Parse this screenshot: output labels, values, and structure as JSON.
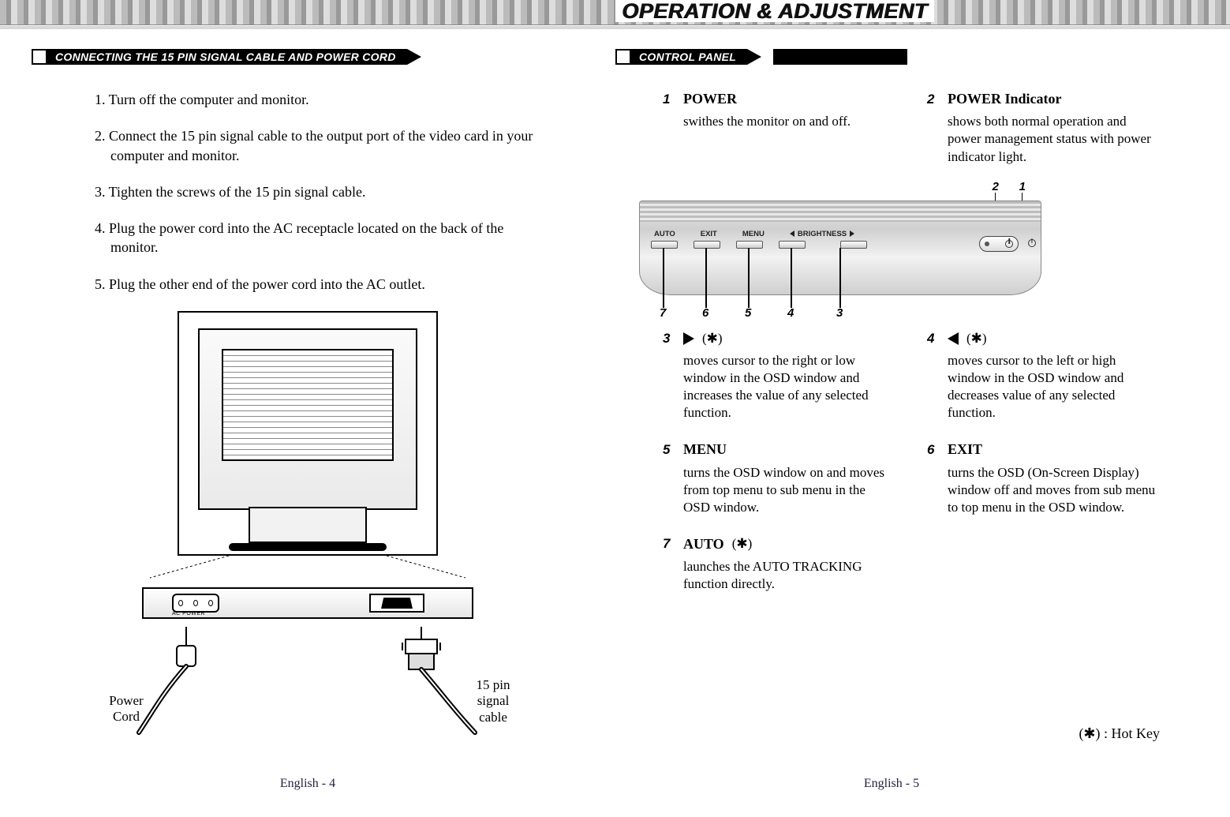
{
  "chapter_title": "OPERATION & ADJUSTMENT",
  "left": {
    "heading": "CONNECTING THE 15 PIN SIGNAL CABLE AND POWER CORD",
    "steps": [
      "1. Turn off the computer and monitor.",
      "2. Connect the 15 pin signal cable to the output port of the video card in your computer and monitor.",
      "3. Tighten the screws of the 15 pin signal cable.",
      "4. Plug the power cord into the AC receptacle located on the back of the monitor.",
      "5. Plug the other end of the power cord into the AC outlet."
    ],
    "ac_label": "AC POWER",
    "power_cord_label": "Power\nCord",
    "signal_cable_label": "15 pin\nsignal\ncable",
    "page_num": "English - 4"
  },
  "right": {
    "heading": "CONTROL PANEL",
    "panel_buttons": {
      "auto": "AUTO",
      "exit": "EXIT",
      "menu": "MENU",
      "brightness": "BRIGHTNESS"
    },
    "items": {
      "one": {
        "num": "1",
        "title": "POWER",
        "desc": "swithes the monitor on and off."
      },
      "two": {
        "num": "2",
        "title": "POWER Indicator",
        "desc": "shows both normal operation and power management status with power indicator light."
      },
      "three": {
        "num": "3",
        "hot": "(✱)",
        "desc": "moves cursor to the right  or low window in the OSD window and  increases the value of any selected function."
      },
      "four": {
        "num": "4",
        "hot": "(✱)",
        "desc": "moves cursor to the left or high window in the OSD window and  decreases value of any selected  function."
      },
      "five": {
        "num": "5",
        "title": "MENU",
        "desc": "turns the OSD window on and moves from top menu to sub menu in the OSD window."
      },
      "six": {
        "num": "6",
        "title": "EXIT",
        "desc": "turns the OSD (On-Screen Display) window off and moves from sub menu to top menu in the OSD window."
      },
      "seven": {
        "num": "7",
        "title": "AUTO",
        "hot": "(✱)",
        "desc": "launches the AUTO TRACKING function directly."
      }
    },
    "callouts": {
      "c1": "1",
      "c2": "2",
      "c3": "3",
      "c4": "4",
      "c5": "5",
      "c6": "6",
      "c7": "7"
    },
    "hotkey_legend": "(✱) : Hot Key",
    "page_num": "English - 5"
  }
}
